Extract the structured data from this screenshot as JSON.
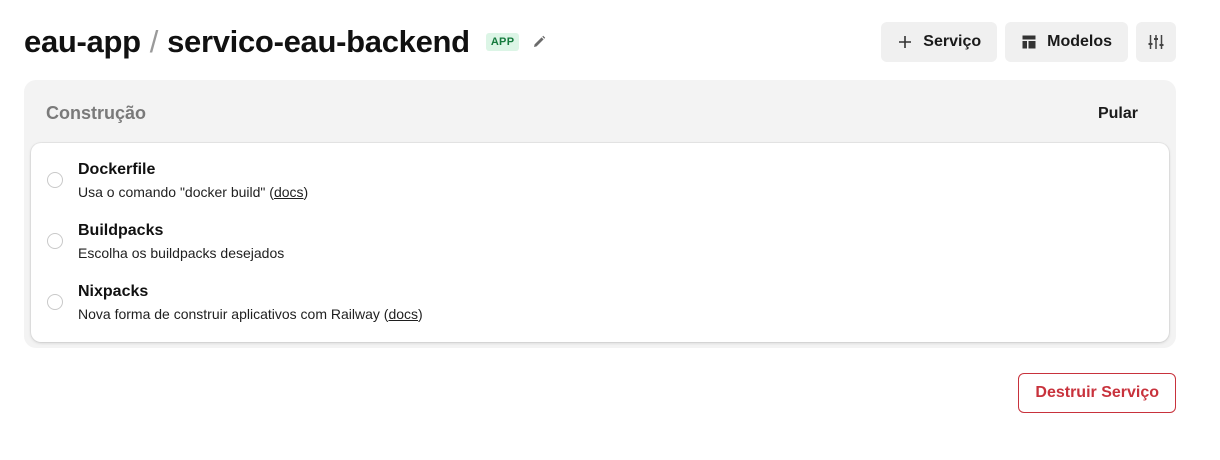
{
  "header": {
    "project": "eau-app",
    "separator": "/",
    "service": "servico-eau-backend",
    "badge": "APP",
    "edit_icon": "pencil-icon",
    "actions": {
      "add_service": {
        "label": "Serviço",
        "icon": "plus-icon"
      },
      "templates": {
        "label": "Modelos",
        "icon": "layout-icon"
      },
      "settings": {
        "icon": "sliders-icon"
      }
    }
  },
  "build": {
    "title": "Construção",
    "skip_label": "Pular",
    "options": [
      {
        "name": "Dockerfile",
        "desc_prefix": "Usa o comando \"docker build\" (",
        "link": "docs",
        "desc_suffix": ")"
      },
      {
        "name": "Buildpacks",
        "desc_prefix": "Escolha os buildpacks desejados",
        "link": "",
        "desc_suffix": ""
      },
      {
        "name": "Nixpacks",
        "desc_prefix": "Nova forma de construir aplicativos com Railway (",
        "link": "docs",
        "desc_suffix": ")"
      }
    ]
  },
  "danger": {
    "destroy_label": "Destruir Serviço"
  },
  "colors": {
    "badge_bg": "#dcf5e6",
    "badge_text": "#157a3d",
    "danger": "#c8323c",
    "panel_bg": "#f3f3f3",
    "button_bg": "#f0f0f0"
  }
}
